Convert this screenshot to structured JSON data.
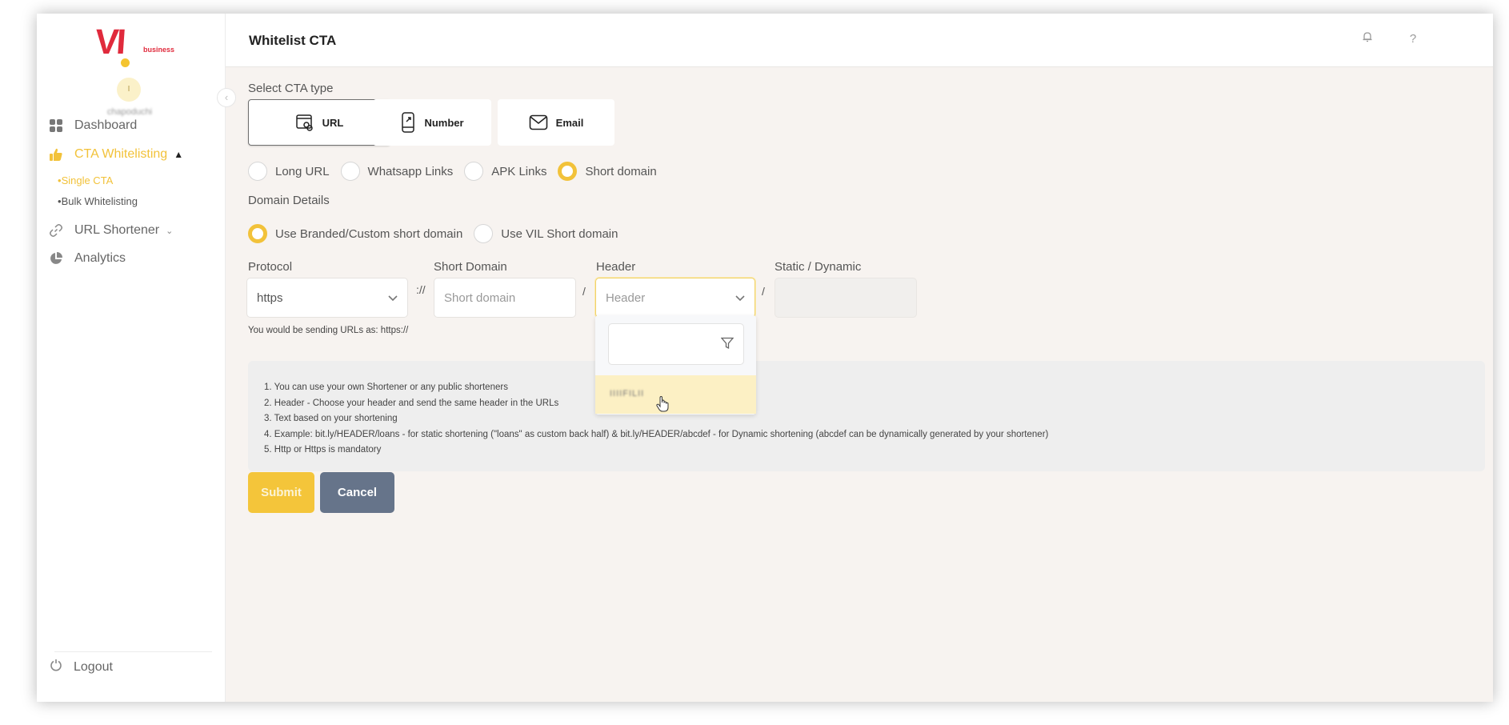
{
  "brand": {
    "logo_text": "VI",
    "logo_subtext": "business",
    "primary_color": "#e02a3c",
    "accent_color": "#f2c23a"
  },
  "user": {
    "avatar_initial": "I",
    "name_blurred": "chapoduchi"
  },
  "sidebar": {
    "items": [
      {
        "label": "Dashboard",
        "icon": "grid-icon",
        "active": false
      },
      {
        "label": "CTA Whitelisting",
        "icon": "thumbs-up-icon",
        "active": true,
        "expanded": true,
        "children": [
          {
            "label": "Single CTA",
            "active": true
          },
          {
            "label": "Bulk Whitelisting",
            "active": false
          }
        ]
      },
      {
        "label": "URL Shortener",
        "icon": "link-icon",
        "active": false,
        "expanded": false
      },
      {
        "label": "Analytics",
        "icon": "pie-chart-icon",
        "active": false
      }
    ],
    "logout_label": "Logout",
    "sub_bullet": "•"
  },
  "header": {
    "title": "Whitelist CTA",
    "icons": [
      "bell-icon",
      "help-icon"
    ],
    "help_glyph": "?"
  },
  "form": {
    "cta_type_label": "Select CTA type",
    "cta_types": [
      {
        "label": "URL",
        "icon": "url-link-icon",
        "selected": true
      },
      {
        "label": "Number",
        "icon": "phone-icon",
        "selected": false
      },
      {
        "label": "Email",
        "icon": "mail-icon",
        "selected": false
      }
    ],
    "url_types": [
      {
        "label": "Long URL",
        "checked": false
      },
      {
        "label": "Whatsapp Links",
        "checked": false
      },
      {
        "label": "APK Links",
        "checked": false
      },
      {
        "label": "Short domain",
        "checked": true
      }
    ],
    "domain_details_label": "Domain Details",
    "domain_options": [
      {
        "label": "Use Branded/Custom short domain",
        "checked": true
      },
      {
        "label": "Use VIL Short domain",
        "checked": false
      }
    ],
    "protocol": {
      "label": "Protocol",
      "value": "https"
    },
    "protocol_sep": "://",
    "short_domain": {
      "label": "Short Domain",
      "placeholder": "Short domain",
      "value": ""
    },
    "path_sep": "/",
    "header": {
      "label": "Header",
      "placeholder": "Header",
      "open": true,
      "filter_value": "",
      "options": [
        "IIIIFILII"
      ],
      "hovered_index": 0
    },
    "static_dynamic": {
      "label": "Static / Dynamic",
      "value": "",
      "disabled": true
    },
    "preview_text": "You would be sending URLs as: https://",
    "notes": [
      "1. You can use your own Shortener or any public shorteners",
      "2. Header - Choose your header and send the same header in the URLs",
      "3. Text based on your shortening",
      "4. Example: bit.ly/HEADER/loans - for static shortening (\"loans\" as custom back half) & bit.ly/HEADER/abcdef - for Dynamic shortening (abcdef can be dynamically generated by your shortener)",
      "5. Http or Https is mandatory"
    ],
    "submit_label": "Submit",
    "cancel_label": "Cancel"
  }
}
